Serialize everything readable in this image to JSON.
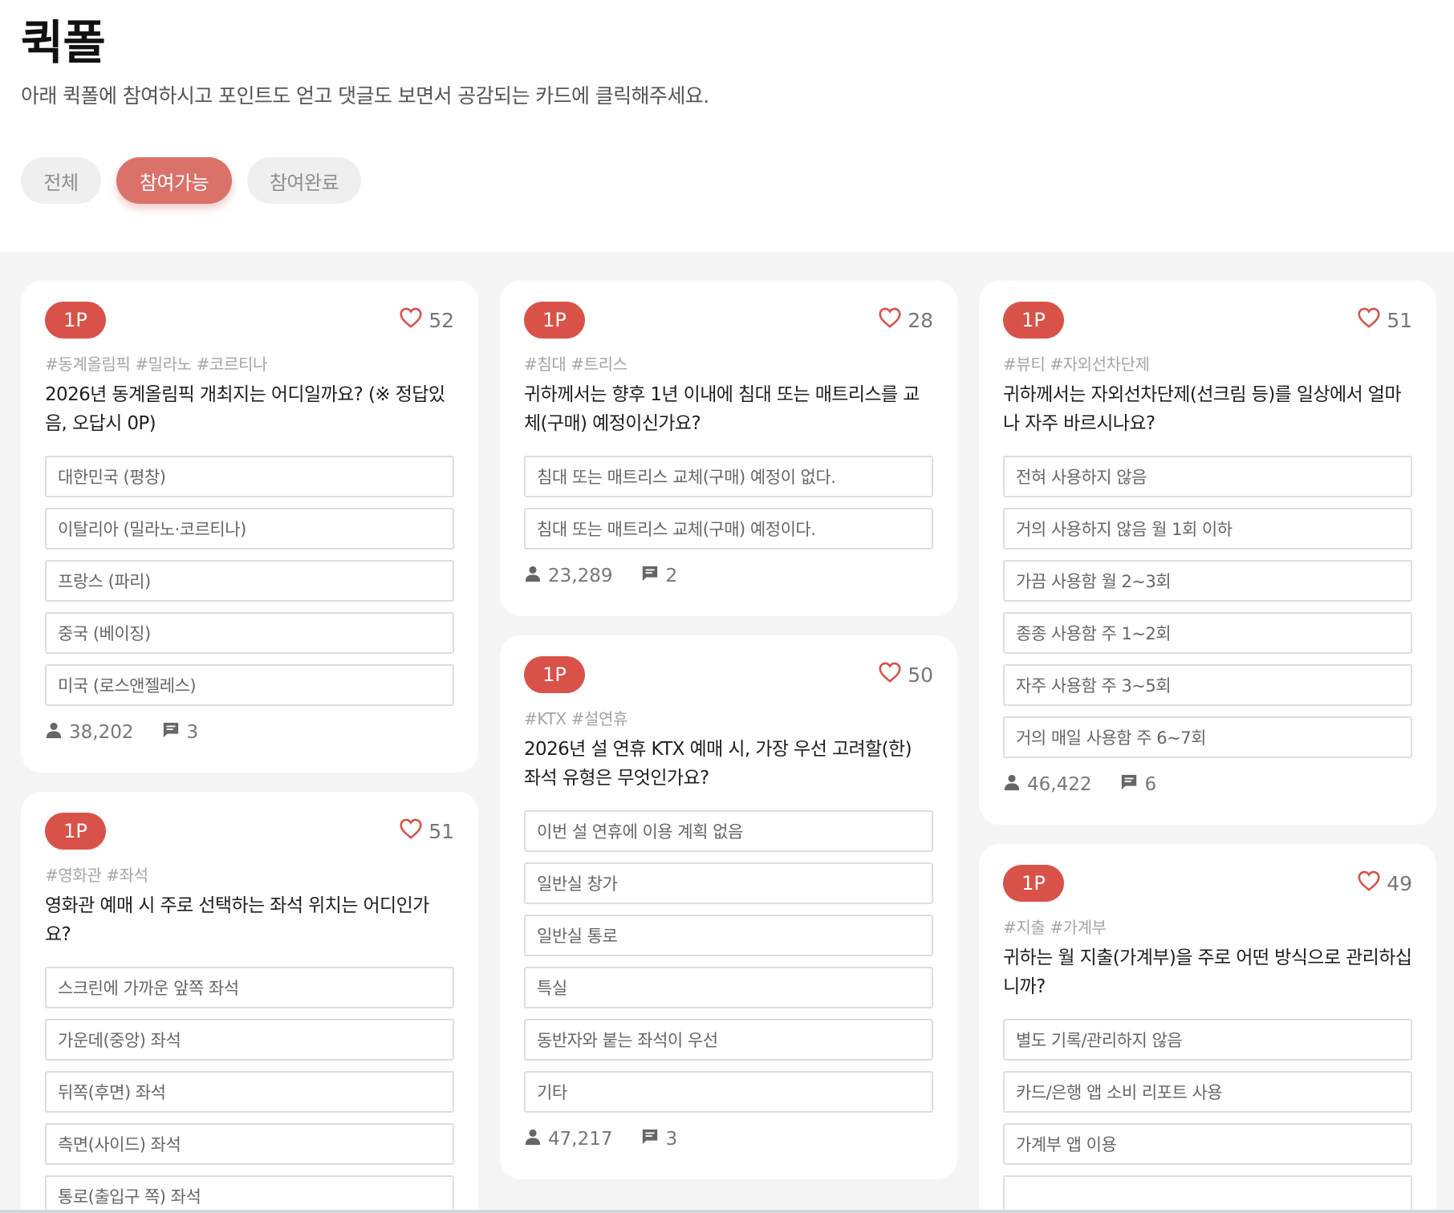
{
  "header": {
    "title": "퀵폴",
    "description": "아래 퀵폴에 참여하시고 포인트도 얻고 댓글도 보면서 공감되는 카드에 클릭해주세요."
  },
  "filters": [
    {
      "label": "전체",
      "active": false
    },
    {
      "label": "참여가능",
      "active": true
    },
    {
      "label": "참여완료",
      "active": false
    }
  ],
  "colors": {
    "accent": "#d9524a",
    "filter_active": "#db7269",
    "board_bg": "#f5f5f5"
  },
  "icons": {
    "like": "heart-outline-icon",
    "participants": "person-icon",
    "comments": "comment-icon"
  },
  "cards": [
    {
      "point": "1P",
      "likes": "52",
      "tags": "#동계올림픽 #밀라노 #코르티나",
      "question": "2026년 동계올림픽 개최지는 어디일까요? (※ 정답있음, 오답시 0P)",
      "options": [
        "대한민국 (평창)",
        "이탈리아 (밀라노·코르티나)",
        "프랑스 (파리)",
        "중국 (베이징)",
        "미국 (로스앤젤레스)"
      ],
      "participants": "38,202",
      "comments": "3"
    },
    {
      "point": "1P",
      "likes": "51",
      "tags": "#영화관 #좌석",
      "question": "영화관 예매 시 주로 선택하는 좌석 위치는 어디인가요?",
      "options": [
        "스크린에 가까운 앞쪽 좌석",
        "가운데(중앙) 좌석",
        "뒤쪽(후면) 좌석",
        "측면(사이드) 좌석",
        "통로(출입구 쪽) 좌석"
      ],
      "participants": "",
      "comments": ""
    },
    {
      "point": "1P",
      "likes": "28",
      "tags": "#침대 #트리스",
      "question": "귀하께서는 향후 1년 이내에 침대 또는 매트리스를 교체(구매) 예정이신가요?",
      "options": [
        "침대 또는 매트리스 교체(구매) 예정이 없다.",
        "침대 또는 매트리스 교체(구매) 예정이다."
      ],
      "participants": "23,289",
      "comments": "2"
    },
    {
      "point": "1P",
      "likes": "50",
      "tags": "#KTX #설연휴",
      "question": "2026년 설 연휴 KTX 예매 시, 가장 우선 고려할(한) 좌석 유형은 무엇인가요?",
      "options": [
        "이번 설 연휴에 이용 계획 없음",
        "일반실 창가",
        "일반실 통로",
        "특실",
        "동반자와 붙는 좌석이 우선",
        "기타"
      ],
      "participants": "47,217",
      "comments": "3"
    },
    {
      "point": "1P",
      "likes": "51",
      "tags": "#뷰티 #자외선차단제",
      "question": "귀하께서는 자외선차단제(선크림 등)를 일상에서 얼마나 자주 바르시나요?",
      "options": [
        "전혀 사용하지 않음",
        "거의 사용하지 않음 월 1회 이하",
        "가끔 사용함 월 2~3회",
        "종종 사용함 주 1~2회",
        "자주 사용함 주 3~5회",
        "거의 매일 사용함 주 6~7회"
      ],
      "participants": "46,422",
      "comments": "6"
    },
    {
      "point": "1P",
      "likes": "49",
      "tags": "#지출 #가계부",
      "question": "귀하는 월 지출(가계부)을 주로 어떤 방식으로 관리하십니까?",
      "options": [
        "별도 기록/관리하지 않음",
        "카드/은행 앱 소비 리포트 사용",
        "가계부 앱 이용",
        ""
      ],
      "participants": "",
      "comments": ""
    }
  ]
}
